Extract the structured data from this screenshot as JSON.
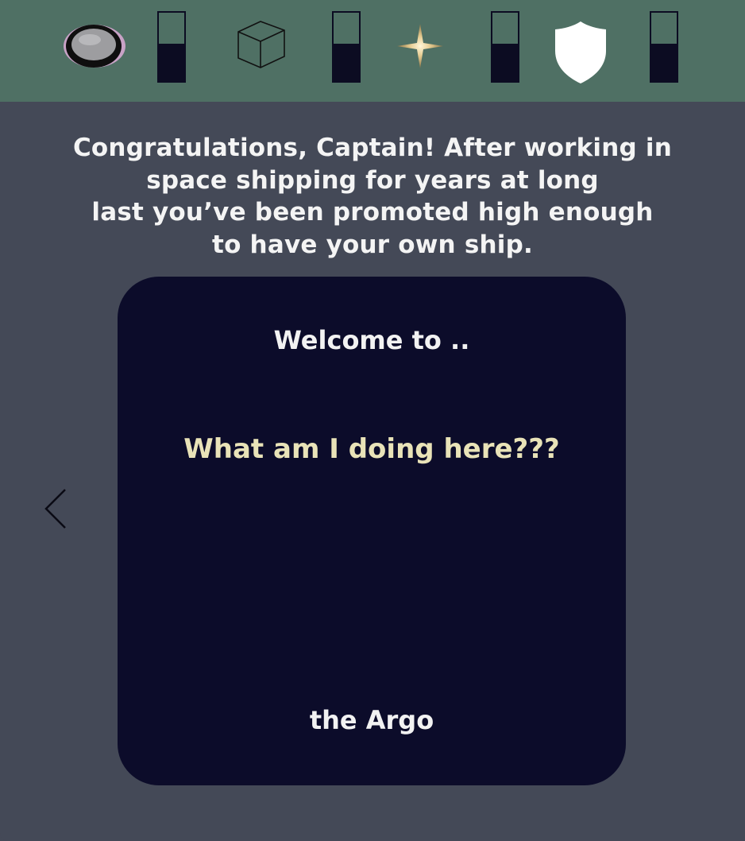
{
  "stats": [
    {
      "icon": "crew-pod-icon",
      "level": 0.55
    },
    {
      "icon": "cargo-cube-icon",
      "level": 0.55
    },
    {
      "icon": "star-icon",
      "level": 0.55
    },
    {
      "icon": "shield-icon",
      "level": 0.55
    }
  ],
  "intro": {
    "text": "Congratulations, Captain! After working in\nspace shipping for years at long\nlast you’ve been promoted high enough\nto have your own ship."
  },
  "card": {
    "welcome": "Welcome to ..",
    "question": "What am I doing here???",
    "ship_name": "the Argo"
  },
  "colors": {
    "background": "#444957",
    "top_bar": "#4f7064",
    "card": "#0c0c2a",
    "question_text": "#e9e3b8"
  }
}
